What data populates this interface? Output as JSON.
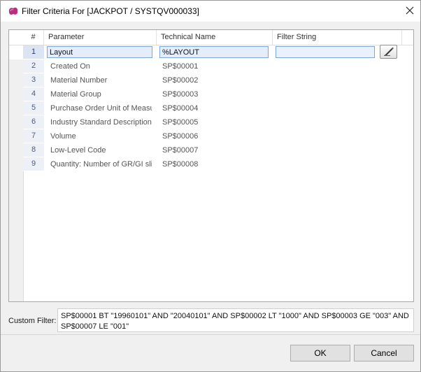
{
  "window": {
    "title": "Filter Criteria For [JACKPOT / SYSTQV000033]",
    "icon": "purple-blob-icon",
    "close_icon": "close-icon"
  },
  "grid": {
    "columns": [
      "#",
      "Parameter",
      "Technical Name",
      "Filter String"
    ],
    "rows": [
      {
        "num": "1",
        "parameter": "Layout",
        "technical": "%LAYOUT",
        "filter": "",
        "selected": true
      },
      {
        "num": "2",
        "parameter": "Created On",
        "technical": "SP$00001",
        "filter": ""
      },
      {
        "num": "3",
        "parameter": "Material Number",
        "technical": "SP$00002",
        "filter": ""
      },
      {
        "num": "4",
        "parameter": "Material Group",
        "technical": "SP$00003",
        "filter": ""
      },
      {
        "num": "5",
        "parameter": "Purchase Order Unit of Measu",
        "technical": "SP$00004",
        "filter": ""
      },
      {
        "num": "6",
        "parameter": "Industry Standard Description",
        "technical": "SP$00005",
        "filter": ""
      },
      {
        "num": "7",
        "parameter": "Volume",
        "technical": "SP$00006",
        "filter": ""
      },
      {
        "num": "8",
        "parameter": "Low-Level Code",
        "technical": "SP$00007",
        "filter": ""
      },
      {
        "num": "9",
        "parameter": "Quantity: Number of GR/GI sli",
        "technical": "SP$00008",
        "filter": ""
      }
    ],
    "edit_icon": "pencil-icon"
  },
  "custom_filter": {
    "label": "Custom Filter:",
    "value": "SP$00001 BT \"19960101\" AND \"20040101\" AND SP$00002 LT \"1000\" AND SP$00003 GE \"003\" AND SP$00007 LE \"001\""
  },
  "buttons": {
    "ok": "OK",
    "cancel": "Cancel"
  }
}
